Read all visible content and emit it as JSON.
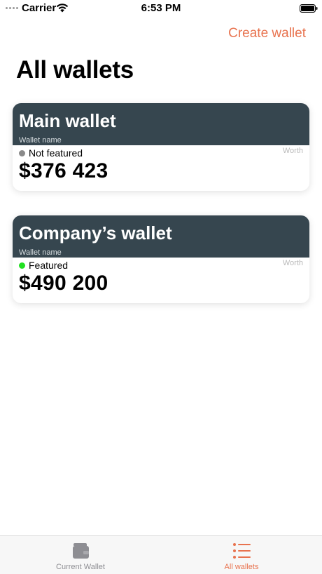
{
  "status_bar": {
    "carrier": "Carrier",
    "time": "6:53 PM",
    "signal_icon": "signal-dots-icon",
    "wifi_icon": "wifi-icon",
    "battery_icon": "battery-icon"
  },
  "nav": {
    "create_wallet_label": "Create wallet",
    "title": "All wallets",
    "accent_color": "#e8734f"
  },
  "wallets": [
    {
      "name": "Main wallet",
      "name_label": "Wallet name",
      "worth_label": "Worth",
      "status": "Not featured",
      "status_color": "#8a8a8a",
      "amount": "$376 423"
    },
    {
      "name": "Company’s wallet",
      "name_label": "Wallet name",
      "worth_label": "Worth",
      "status": "Featured",
      "status_color": "#22e022",
      "amount": "$490 200"
    }
  ],
  "tab_bar": {
    "tabs": [
      {
        "label": "Current Wallet",
        "icon": "wallet-icon",
        "selected": false,
        "color": "#8e8e93"
      },
      {
        "label": "All wallets",
        "icon": "list-icon",
        "selected": true,
        "color": "#e8734f"
      }
    ]
  },
  "colors": {
    "card_header": "#36464f",
    "accent": "#e8734f"
  }
}
